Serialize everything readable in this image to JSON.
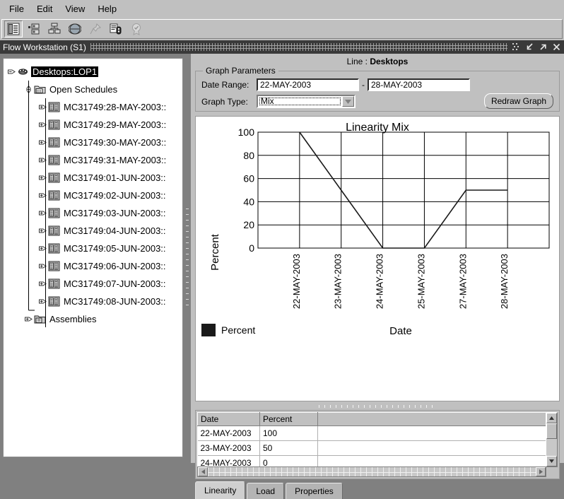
{
  "menu": {
    "items": [
      "File",
      "Edit",
      "View",
      "Help"
    ]
  },
  "toolbar": {
    "buttons": [
      {
        "name": "schedule-list-icon",
        "title": "Schedules"
      },
      {
        "name": "sequence-icon",
        "title": "Sequence"
      },
      {
        "name": "network-icon",
        "title": "Network"
      },
      {
        "name": "globe-icon",
        "title": "Globe"
      },
      {
        "name": "pin-icon",
        "title": "Pin"
      },
      {
        "name": "report-icon",
        "title": "Report"
      },
      {
        "name": "award-icon",
        "title": "Certify"
      }
    ]
  },
  "window": {
    "title": "Flow Workstation  (S1)",
    "buttons": [
      "restore",
      "minimize",
      "maximize",
      "close"
    ]
  },
  "tree": {
    "root": {
      "label": "Desktops:LOP1",
      "icon": "line-icon",
      "selected": true,
      "toggle": "minus"
    },
    "folder": {
      "label": "Open Schedules",
      "icon": "folder-icon",
      "toggle": "minus"
    },
    "schedules": [
      {
        "label": "MC31749:28-MAY-2003::",
        "icon": "schedule-icon",
        "toggle": "plus"
      },
      {
        "label": "MC31749:29-MAY-2003::",
        "icon": "schedule-icon",
        "toggle": "plus"
      },
      {
        "label": "MC31749:30-MAY-2003::",
        "icon": "schedule-icon",
        "toggle": "plus"
      },
      {
        "label": "MC31749:31-MAY-2003::",
        "icon": "schedule-icon",
        "toggle": "plus"
      },
      {
        "label": "MC31749:01-JUN-2003::",
        "icon": "schedule-icon",
        "toggle": "plus"
      },
      {
        "label": "MC31749:02-JUN-2003::",
        "icon": "schedule-icon",
        "toggle": "plus"
      },
      {
        "label": "MC31749:03-JUN-2003::",
        "icon": "schedule-icon",
        "toggle": "plus"
      },
      {
        "label": "MC31749:04-JUN-2003::",
        "icon": "schedule-icon",
        "toggle": "plus"
      },
      {
        "label": "MC31749:05-JUN-2003::",
        "icon": "schedule-icon",
        "toggle": "plus"
      },
      {
        "label": "MC31749:06-JUN-2003::",
        "icon": "schedule-icon",
        "toggle": "plus"
      },
      {
        "label": "MC31749:07-JUN-2003::",
        "icon": "schedule-icon",
        "toggle": "plus"
      },
      {
        "label": "MC31749:08-JUN-2003::",
        "icon": "schedule-icon",
        "toggle": "plus"
      }
    ],
    "assemblies": {
      "label": "Assemblies",
      "icon": "assemblies-icon",
      "toggle": "plus"
    }
  },
  "header": {
    "line_label": "Line :",
    "line_value": "Desktops"
  },
  "params": {
    "group_title": "Graph Parameters",
    "date_range_label": "Date Range:",
    "date_from": "22-MAY-2003",
    "date_separator": "-",
    "date_to": "28-MAY-2003",
    "graph_type_label": "Graph Type:",
    "graph_type_value": "Mix",
    "graph_type_options": [
      "Mix"
    ],
    "redraw_label": "Redraw Graph"
  },
  "chart_data": {
    "type": "line",
    "title": "Linearity Mix",
    "xlabel": "Date",
    "ylabel": "Percent",
    "categories": [
      "22-MAY-2003",
      "23-MAY-2003",
      "24-MAY-2003",
      "25-MAY-2003",
      "27-MAY-2003",
      "28-MAY-2003"
    ],
    "series": [
      {
        "name": "Percent",
        "color": "#1a1a1a",
        "values": [
          100,
          50,
          0,
          0,
          50,
          50
        ]
      }
    ],
    "yticks": [
      0,
      20,
      40,
      60,
      80,
      100
    ],
    "ylim": [
      0,
      100
    ],
    "grid": true,
    "legend_position": "bottom-left",
    "legend": [
      {
        "label": "Percent",
        "color": "#1a1a1a"
      }
    ]
  },
  "table": {
    "columns": [
      "Date",
      "Percent",
      ""
    ],
    "rows": [
      [
        "22-MAY-2003",
        "100",
        ""
      ],
      [
        "23-MAY-2003",
        "50",
        ""
      ],
      [
        "24-MAY-2003",
        "0",
        ""
      ]
    ]
  },
  "tabs": {
    "items": [
      {
        "label": "Linearity",
        "active": true
      },
      {
        "label": "Load",
        "active": false
      },
      {
        "label": "Properties",
        "active": false
      }
    ]
  }
}
